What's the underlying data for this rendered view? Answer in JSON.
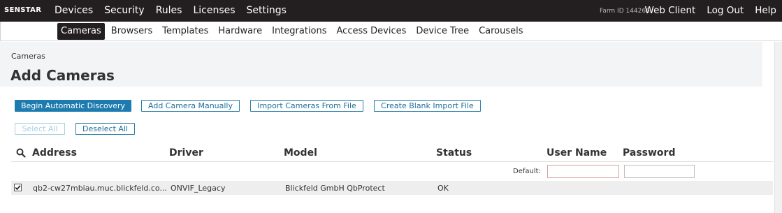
{
  "brand": "SENSTAR",
  "topnav": [
    "Devices",
    "Security",
    "Rules",
    "Licenses",
    "Settings"
  ],
  "farm_id": "Farm ID 144266",
  "rightnav": [
    "Web Client",
    "Log Out",
    "Help"
  ],
  "subnav": {
    "items": [
      "Cameras",
      "Browsers",
      "Templates",
      "Hardware",
      "Integrations",
      "Access Devices",
      "Device Tree",
      "Carousels"
    ],
    "active": "Cameras"
  },
  "breadcrumb": "Cameras",
  "page_title": "Add Cameras",
  "actions": {
    "discover": "Begin Automatic Discovery",
    "add_manual": "Add Camera Manually",
    "import_file": "Import Cameras From File",
    "blank_import": "Create Blank Import File",
    "select_all": "Select All",
    "deselect_all": "Deselect All"
  },
  "table": {
    "headers": [
      "Address",
      "Driver",
      "Model",
      "Status",
      "User Name",
      "Password"
    ],
    "default_label": "Default:",
    "default_username": "",
    "default_password": "",
    "rows": [
      {
        "checked": true,
        "address": "qb2-cw27mbiau.muc.blickfeld.co...",
        "driver": "ONVIF_Legacy",
        "model": "Blickfeld GmbH QbProtect",
        "status": "OK"
      }
    ]
  },
  "colors": {
    "topbar": "#231f20",
    "primary": "#1d7bb0",
    "header_bg": "#f3f4f6"
  }
}
